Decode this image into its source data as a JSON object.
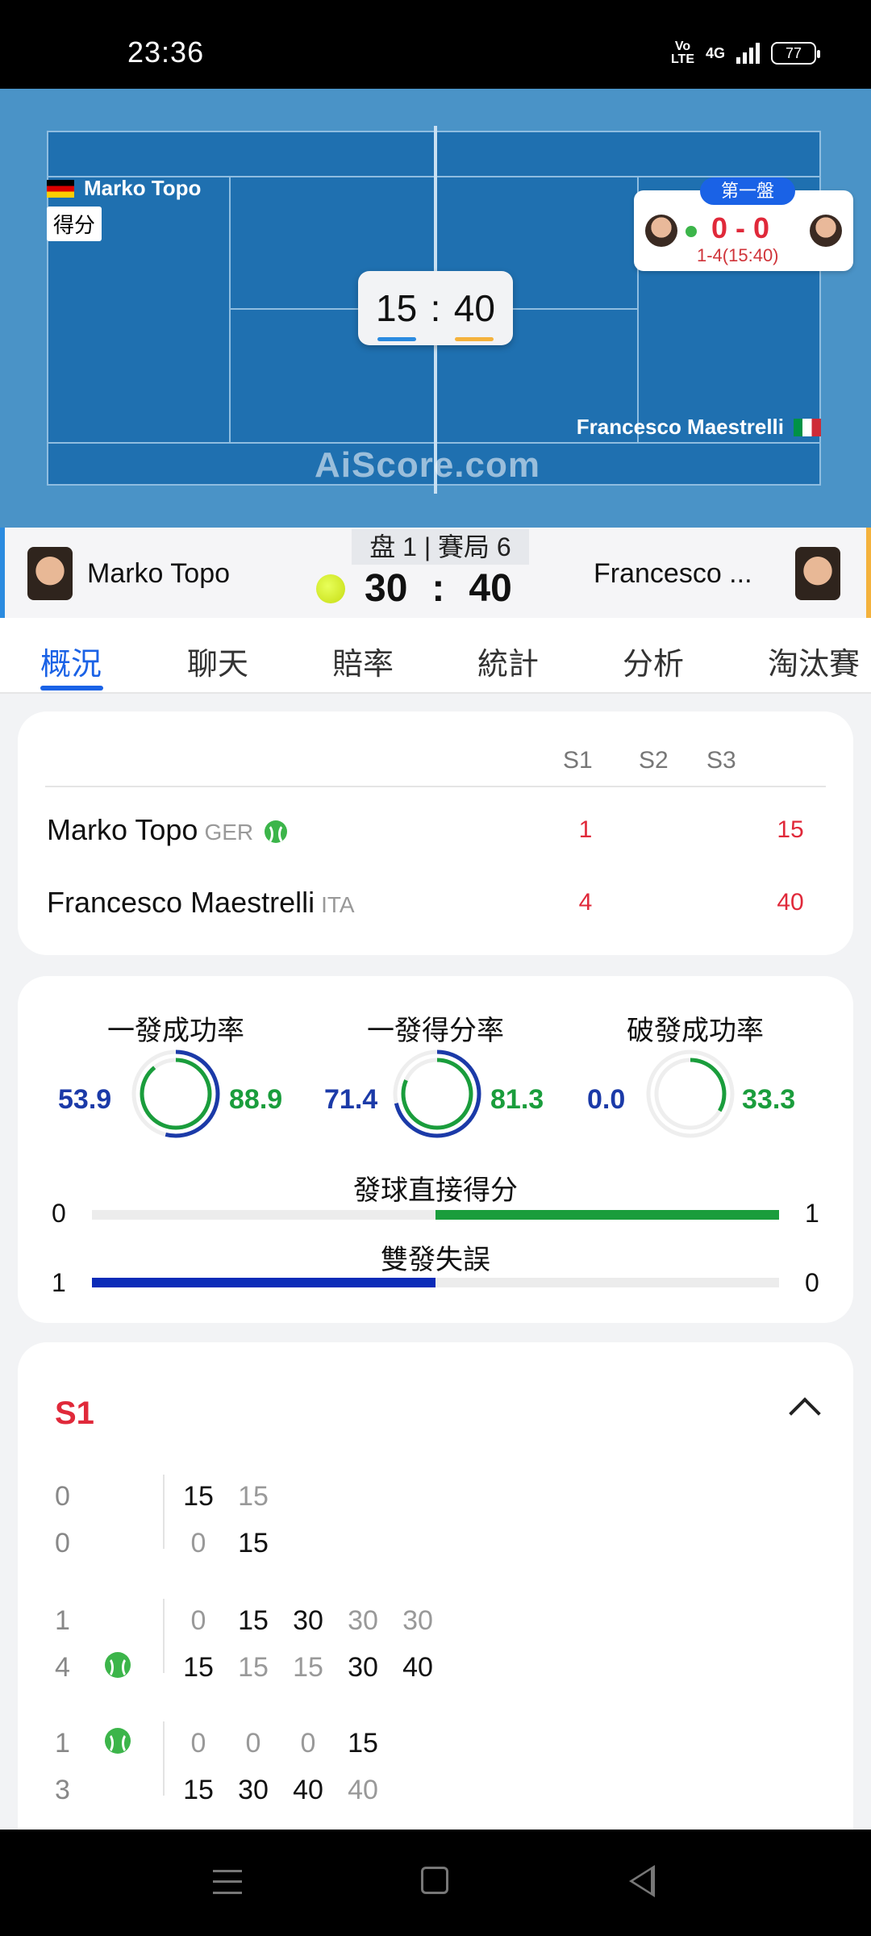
{
  "status_bar": {
    "time": "23:36",
    "network_top": "Vo",
    "network_bottom": "LTE",
    "signal": "4G",
    "battery": "77"
  },
  "court": {
    "server_name": "Marko Topo",
    "point_tag": "得分",
    "receiver_name": "Francesco Maestrelli",
    "watermark": "AiScore.com",
    "game_left": "15",
    "game_sep": ":",
    "game_right": "40"
  },
  "mini_card": {
    "set_label": "第一盤",
    "score": "0 - 0",
    "sub": "1-4(15:40)"
  },
  "players_bar": {
    "home_name": "Marko Topo",
    "away_name": "Francesco ...",
    "label": "盘 1 | 賽局 6",
    "home_points": "30",
    "sep": ":",
    "away_points": "40"
  },
  "tabs": [
    "概況",
    "聊天",
    "賠率",
    "統計",
    "分析",
    "淘汰賽"
  ],
  "scoreboard": {
    "headers": [
      "S1",
      "S2",
      "S3"
    ],
    "rows": [
      {
        "name": "Marko Topo",
        "country": "GER",
        "s1": "1",
        "s3": "15"
      },
      {
        "name": "Francesco Maestrelli",
        "country": "ITA",
        "s1": "4",
        "s3": "40"
      }
    ]
  },
  "stats": {
    "rings": [
      {
        "title": "一發成功率",
        "left": "53.9",
        "right": "88.9"
      },
      {
        "title": "一發得分率",
        "left": "71.4",
        "right": "81.3"
      },
      {
        "title": "破發成功率",
        "left": "0.0",
        "right": "33.3"
      }
    ],
    "bars": [
      {
        "title": "發球直接得分",
        "left": "0",
        "right": "1"
      },
      {
        "title": "雙發失誤",
        "left": "1",
        "right": "0"
      }
    ]
  },
  "pbp": {
    "title": "S1",
    "games": [
      {
        "home_games": "0",
        "away_games": "0",
        "home_points": [
          "15",
          "15"
        ],
        "away_points": [
          "0",
          "15"
        ]
      },
      {
        "home_games": "1",
        "away_games": "4",
        "home_points": [
          "0",
          "15",
          "30",
          "30",
          "30"
        ],
        "away_points": [
          "15",
          "15",
          "15",
          "30",
          "40"
        ]
      },
      {
        "home_games": "1",
        "away_games": "3",
        "home_points": [
          "0",
          "0",
          "0",
          "15"
        ],
        "away_points": [
          "15",
          "30",
          "40",
          "40"
        ]
      }
    ]
  },
  "colors": {
    "accent": "#1a62e6",
    "home": "#1b3aa8",
    "away": "#1a9d3c",
    "score_red": "#e0293a",
    "court": "#1f70b0"
  }
}
